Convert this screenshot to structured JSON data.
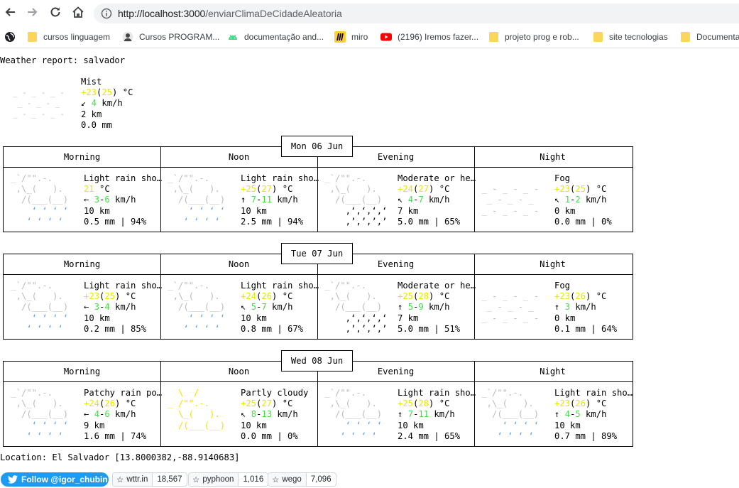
{
  "browser": {
    "url_host": "http://localhost:3000",
    "url_path": "/enviarClimaDeCidadeAleatoria",
    "bookmarks": [
      {
        "label": "",
        "icon": "globe-icon"
      },
      {
        "label": "cursos linguagem",
        "icon": "folder-icon"
      },
      {
        "label": "Cursos  PROGRAM...",
        "icon": "user-avatar-icon"
      },
      {
        "label": "documentação and...",
        "icon": "android-icon"
      },
      {
        "label": "miro",
        "icon": "miro-icon"
      },
      {
        "label": "(2196) Iremos fazer...",
        "icon": "youtube-icon"
      },
      {
        "label": "projeto prog e rob...",
        "icon": "folder-icon"
      },
      {
        "label": "site tecnologias",
        "icon": "folder-icon"
      },
      {
        "label": "Documenta",
        "icon": "folder-icon"
      }
    ]
  },
  "report": {
    "title": "Weather report: salvador",
    "current": {
      "condition": "Mist",
      "temp_a": "+23",
      "temp_b": "25",
      "temp_unit": "°C",
      "wind_arrow": "↙",
      "wind": "4",
      "wind_unit": "km/h",
      "visibility": "2 km",
      "precip": "0.0 mm"
    },
    "columns": [
      "Morning",
      "Noon",
      "Evening",
      "Night"
    ],
    "days": [
      {
        "date": "Mon 06 Jun",
        "slots": [
          {
            "icon": "rain",
            "desc": "Light rain sho…",
            "t1": "21",
            "t2": "",
            "arrow": "←",
            "w1": "3",
            "w2": "6",
            "vis": "10 km",
            "precip": "0.5 mm",
            "prob": "94%"
          },
          {
            "icon": "rain",
            "desc": "Light rain sho…",
            "t1": "+25",
            "t2": "27",
            "arrow": "↑",
            "w1": "7",
            "w2": "11",
            "vis": "10 km",
            "precip": "2.5 mm",
            "prob": "94%"
          },
          {
            "icon": "heavy",
            "desc": "Moderate or he…",
            "t1": "+24",
            "t2": "27",
            "arrow": "↖",
            "w1": "4",
            "w2": "7",
            "vis": "7 km",
            "precip": "5.0 mm",
            "prob": "65%"
          },
          {
            "icon": "fog",
            "desc": "Fog",
            "t1": "+23",
            "t2": "25",
            "arrow": "↖",
            "w1": "1",
            "w2": "2",
            "vis": "0 km",
            "precip": "0.0 mm",
            "prob": "0%"
          }
        ]
      },
      {
        "date": "Tue 07 Jun",
        "slots": [
          {
            "icon": "rain",
            "desc": "Light rain sho…",
            "t1": "+23",
            "t2": "25",
            "arrow": "←",
            "w1": "3",
            "w2": "4",
            "vis": "10 km",
            "precip": "0.2 mm",
            "prob": "85%"
          },
          {
            "icon": "rain",
            "desc": "Light rain sho…",
            "t1": "+24",
            "t2": "26",
            "arrow": "↖",
            "w1": "5",
            "w2": "7",
            "vis": "10 km",
            "precip": "0.8 mm",
            "prob": "67%"
          },
          {
            "icon": "heavy",
            "desc": "Moderate or he…",
            "t1": "+25",
            "t2": "28",
            "arrow": "↑",
            "w1": "5",
            "w2": "9",
            "vis": "7 km",
            "precip": "5.0 mm",
            "prob": "51%"
          },
          {
            "icon": "fog",
            "desc": "Fog",
            "t1": "+23",
            "t2": "26",
            "arrow": "↑",
            "w1": "3",
            "w2": "",
            "vis": "0 km",
            "precip": "0.1 mm",
            "prob": "64%"
          }
        ]
      },
      {
        "date": "Wed 08 Jun",
        "slots": [
          {
            "icon": "rain",
            "desc": "Patchy rain po…",
            "t1": "+24",
            "t2": "26",
            "arrow": "←",
            "w1": "4",
            "w2": "6",
            "vis": "9 km",
            "precip": "1.6 mm",
            "prob": "74%"
          },
          {
            "icon": "partly",
            "desc": "Partly cloudy",
            "t1": "+25",
            "t2": "27",
            "arrow": "↖",
            "w1": "8",
            "w2": "13",
            "vis": "10 km",
            "precip": "0.0 mm",
            "prob": "0%"
          },
          {
            "icon": "rain",
            "desc": "Light rain sho…",
            "t1": "+25",
            "t2": "28",
            "arrow": "↑",
            "w1": "7",
            "w2": "11",
            "vis": "10 km",
            "precip": "2.4 mm",
            "prob": "65%"
          },
          {
            "icon": "rain",
            "desc": "Light rain sho…",
            "t1": "+23",
            "t2": "26",
            "arrow": "↑",
            "w1": "4",
            "w2": "5",
            "vis": "10 km",
            "precip": "0.7 mm",
            "prob": "89%"
          }
        ]
      }
    ],
    "location": "Location: El Salvador [13.8000382,-88.9140683]"
  },
  "footer": {
    "follow_label": "Follow @igor_chubin",
    "repos": [
      {
        "name": "wttr.in",
        "count": "18,567"
      },
      {
        "name": "pyphoon",
        "count": "1,016"
      },
      {
        "name": "wego",
        "count": "7,096"
      }
    ]
  },
  "colors": {
    "temp": "#e6e600",
    "wind": "#44dd44",
    "rain": "#5aa0ff",
    "cloud": "#bbbbbb",
    "twitter": "#1d9bf0"
  }
}
